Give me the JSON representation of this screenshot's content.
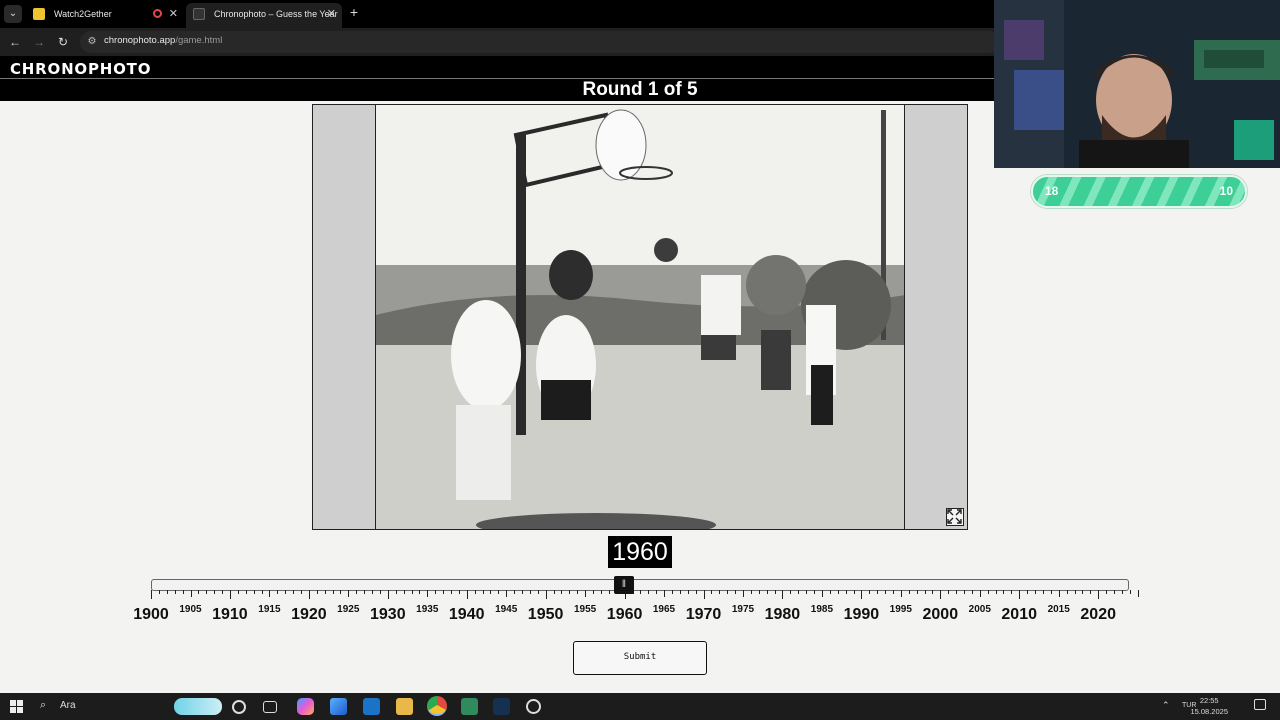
{
  "browser": {
    "tabs": [
      {
        "title": "Watch2Gether",
        "active": false
      },
      {
        "title": "Chronophoto – Guess the Year",
        "active": true
      }
    ],
    "url_host": "chronophoto.app",
    "url_path": "/game.html",
    "icons": [
      "tab-list-icon",
      "back-icon",
      "forward-icon",
      "reload-icon",
      "site-info-icon",
      "new-tab-icon",
      "close-icon",
      "recording-icon"
    ]
  },
  "header": {
    "logo": "CHRONOPHOTO",
    "round_label": "Round 1 of 5"
  },
  "game": {
    "selected_year": "1960",
    "slider": {
      "min": 1900,
      "max": 2025,
      "value": 1960
    },
    "major_labels": [
      "1900",
      "1910",
      "1920",
      "1930",
      "1940",
      "1950",
      "1960",
      "1970",
      "1980",
      "1990",
      "2000",
      "2010",
      "2020"
    ],
    "minor_labels": [
      "1905",
      "1915",
      "1925",
      "1935",
      "1945",
      "1955",
      "1965",
      "1975",
      "1985",
      "1995",
      "2005",
      "2015"
    ],
    "submit_label": "Submit",
    "photo_icon": "fullscreen-icon"
  },
  "overlay": {
    "score_left": "18",
    "score_right": "10",
    "score_colors": {
      "primary": "#3dcf96",
      "stripe": "#7fe6bd"
    }
  },
  "taskbar": {
    "search_placeholder": "Ara",
    "language": "TUR",
    "time": "22:55",
    "date": "15.08.2025"
  }
}
